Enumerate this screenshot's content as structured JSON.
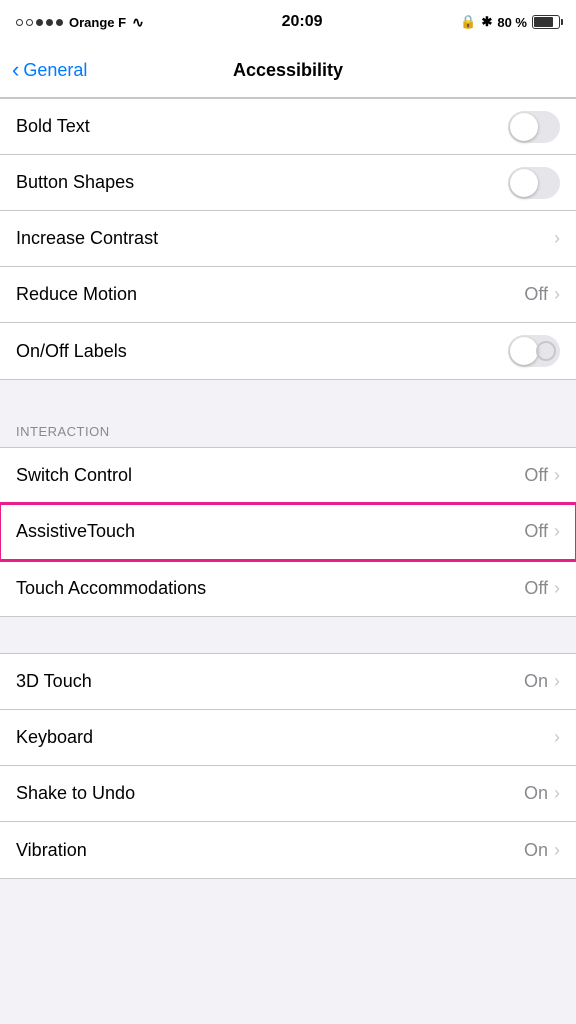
{
  "statusBar": {
    "carrier": "Orange F",
    "time": "20:09",
    "battery": "80 %",
    "lockIcon": "🔒",
    "bluetoothIcon": "✱"
  },
  "nav": {
    "backLabel": "General",
    "title": "Accessibility"
  },
  "groups": [
    {
      "id": "vision",
      "rows": [
        {
          "id": "bold-text",
          "label": "Bold Text",
          "type": "toggle",
          "value": "off"
        },
        {
          "id": "button-shapes",
          "label": "Button Shapes",
          "type": "toggle",
          "value": "off"
        },
        {
          "id": "increase-contrast",
          "label": "Increase Contrast",
          "type": "chevron",
          "value": ""
        },
        {
          "id": "reduce-motion",
          "label": "Reduce Motion",
          "type": "value-chevron",
          "value": "Off"
        },
        {
          "id": "onoff-labels",
          "label": "On/Off Labels",
          "type": "toggle-onoff",
          "value": "off"
        }
      ]
    },
    {
      "id": "interaction",
      "header": "INTERACTION",
      "rows": [
        {
          "id": "switch-control",
          "label": "Switch Control",
          "type": "value-chevron",
          "value": "Off"
        },
        {
          "id": "assistive-touch",
          "label": "AssistiveTouch",
          "type": "value-chevron",
          "value": "Off",
          "highlighted": true
        },
        {
          "id": "touch-accommodations",
          "label": "Touch Accommodations",
          "type": "value-chevron",
          "value": "Off"
        }
      ]
    },
    {
      "id": "misc",
      "header": "",
      "rows": [
        {
          "id": "3d-touch",
          "label": "3D Touch",
          "type": "value-chevron",
          "value": "On"
        },
        {
          "id": "keyboard",
          "label": "Keyboard",
          "type": "chevron",
          "value": ""
        },
        {
          "id": "shake-to-undo",
          "label": "Shake to Undo",
          "type": "value-chevron",
          "value": "On"
        },
        {
          "id": "vibration",
          "label": "Vibration",
          "type": "value-chevron",
          "value": "On"
        }
      ]
    }
  ]
}
